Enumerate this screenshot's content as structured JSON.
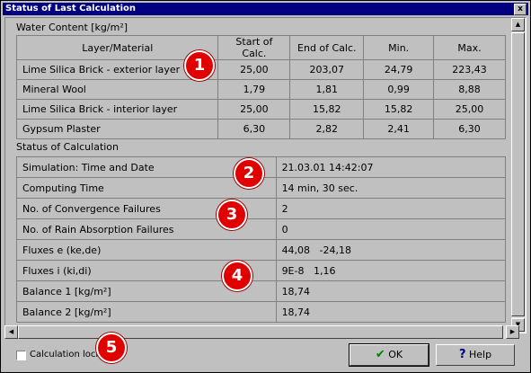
{
  "window": {
    "title": "Status of Last Calculation",
    "close_glyph": "x"
  },
  "water_content": {
    "label": "Water Content [kg/m²]",
    "columns": [
      "Layer/Material",
      "Start of Calc.",
      "End of Calc.",
      "Min.",
      "Max."
    ],
    "rows": [
      [
        "Lime Silica Brick - exterior layer",
        "25,00",
        "203,07",
        "24,79",
        "223,43"
      ],
      [
        "Mineral Wool",
        "1,79",
        "1,81",
        "0,99",
        "8,88"
      ],
      [
        "Lime Silica Brick - interior layer",
        "25,00",
        "15,82",
        "15,82",
        "25,00"
      ],
      [
        "Gypsum Plaster",
        "6,30",
        "2,82",
        "2,41",
        "6,30"
      ]
    ]
  },
  "status": {
    "label": "Status of Calculation",
    "rows": [
      [
        "Simulation: Time and Date",
        "21.03.01 14:42:07"
      ],
      [
        "Computing Time",
        "14 min, 30 sec."
      ],
      [
        "No. of Convergence Failures",
        "2"
      ],
      [
        "No. of Rain Absorption Failures",
        "0"
      ],
      [
        "Fluxes e (ke,de)",
        "44,08   -24,18"
      ],
      [
        "Fluxes i (ki,di)",
        "9E-8   1,16"
      ],
      [
        "Balance 1 [kg/m²]",
        "18,74"
      ],
      [
        "Balance 2 [kg/m²]",
        "18,74"
      ]
    ]
  },
  "badges": [
    "1",
    "2",
    "3",
    "4",
    "5"
  ],
  "footer": {
    "checkbox_label": "Calculation locked",
    "checkbox_checked": false,
    "ok_label": "OK",
    "help_label": "Help",
    "ok_icon": "checkmark-icon",
    "help_icon": "question-icon"
  },
  "colors": {
    "titlebar": "#000080",
    "badge": "#e00000",
    "ok_check": "#008000",
    "help_icon": "#000080"
  }
}
